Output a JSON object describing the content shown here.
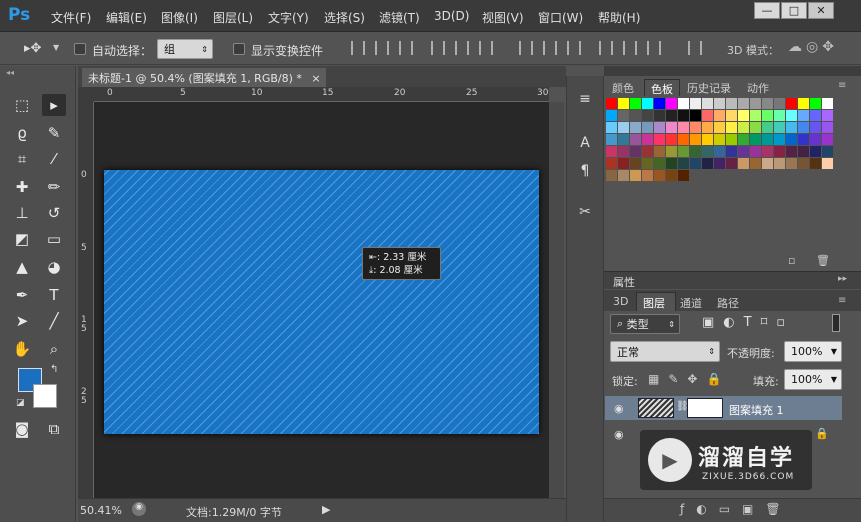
{
  "app": {
    "logo": "Ps",
    "title": "未标题-1 @ 50.4% (图案填充 1, RGB/8) *"
  },
  "menu": [
    "文件(F)",
    "编辑(E)",
    "图像(I)",
    "图层(L)",
    "文字(Y)",
    "选择(S)",
    "滤镜(T)",
    "3D(D)",
    "视图(V)",
    "窗口(W)",
    "帮助(H)"
  ],
  "window_controls": {
    "minimize": "—",
    "maximize": "□",
    "close": "✕"
  },
  "options": {
    "auto_select_label": "自动选择：",
    "auto_select_value": "组",
    "show_transform": "显示变换控件",
    "mode_3d": "3D 模式："
  },
  "document": {
    "tab_label": "未标题-1 @ 50.4% (图案填充 1, RGB/8) *",
    "tab_close": "×"
  },
  "ruler_h": [
    "0",
    "5",
    "10",
    "15",
    "20",
    "25",
    "30"
  ],
  "ruler_v": [
    "0",
    "5",
    "1",
    "5",
    "2",
    "5"
  ],
  "tooltip": {
    "width": "2.33 厘米",
    "height": "2.08 厘米"
  },
  "status": {
    "zoom": "50.41%",
    "doc": "文档:1.29M/0 字节"
  },
  "panels": {
    "top_tabs": [
      "颜色",
      "色板",
      "历史记录",
      "动作"
    ],
    "attr_tab": "属性",
    "layer_tabs": [
      "3D",
      "图层",
      "通道",
      "路径"
    ]
  },
  "layers_panel": {
    "filter": "类型",
    "blend": "正常",
    "opacity_label": "不透明度:",
    "opacity": "100%",
    "lock_label": "锁定:",
    "fill_label": "填充:",
    "fill": "100%",
    "layer_name": "图案填充 1"
  },
  "watermark": {
    "brand": "溜溜自学",
    "url": "ZIXUE.3D66.COM"
  },
  "swatches": [
    "#ff0000",
    "#ffff00",
    "#00ff00",
    "#00ffff",
    "#0000ff",
    "#ff00ff",
    "#ffffff",
    "#eeeeee",
    "#dddddd",
    "#cccccc",
    "#bbbbbb",
    "#aaaaaa",
    "#999999",
    "#888888",
    "#777777",
    "#ff0000",
    "#ffff00",
    "#00ff00",
    "#ffffff",
    "#00a8ff",
    "#666666",
    "#555555",
    "#444444",
    "#333333",
    "#222222",
    "#111111",
    "#000000",
    "#ff6666",
    "#ffaa66",
    "#ffd966",
    "#ffff66",
    "#aaff66",
    "#66ff66",
    "#66ffaa",
    "#66ffff",
    "#66aaff",
    "#6666ff",
    "#aa66ff",
    "#66ccff",
    "#99ccee",
    "#88aacc",
    "#7799bb",
    "#aa88cc",
    "#ee88cc",
    "#ff88aa",
    "#ff8866",
    "#ffaa44",
    "#ffcc44",
    "#ffee44",
    "#ccee44",
    "#88dd44",
    "#44cc88",
    "#44ccbb",
    "#44bbee",
    "#4488ee",
    "#6655ee",
    "#9955ee",
    "#4499cc",
    "#337799",
    "#995599",
    "#cc3399",
    "#ff3366",
    "#ff3333",
    "#ff6600",
    "#ff9900",
    "#ffcc00",
    "#cccc00",
    "#99cc00",
    "#33aa33",
    "#009966",
    "#009999",
    "#0099cc",
    "#0066cc",
    "#3333cc",
    "#6633cc",
    "#9933cc",
    "#cc3366",
    "#993366",
    "#663366",
    "#993333",
    "#996633",
    "#999933",
    "#669933",
    "#336633",
    "#336666",
    "#336699",
    "#333399",
    "#663399",
    "#993399",
    "#aa3366",
    "#882244",
    "#552244",
    "#442244",
    "#222266",
    "#224466",
    "#aa3322",
    "#882222",
    "#664422",
    "#666622",
    "#446622",
    "#224422",
    "#224444",
    "#224466",
    "#222244",
    "#442266",
    "#662244",
    "#cc9966",
    "#996633",
    "#ccaa88",
    "#bb9977",
    "#997755",
    "#775533",
    "#553311",
    "#ffccaa",
    "#886644",
    "#aa8866",
    "#cc9955",
    "#bb7744",
    "#995522",
    "#774411",
    "#552200"
  ]
}
